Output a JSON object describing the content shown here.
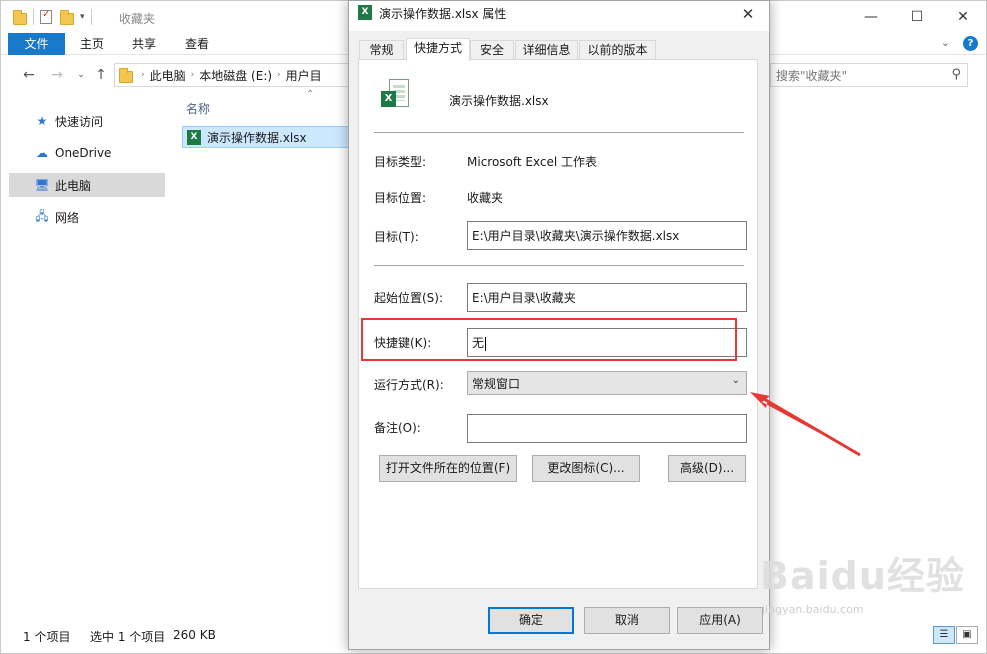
{
  "explorer": {
    "title": "收藏夹",
    "ribbon_tabs": [
      "文件",
      "主页",
      "共享",
      "查看"
    ],
    "help_icon": "?",
    "breadcrumbs": [
      "此电脑",
      "本地磁盘 (E:)",
      "用户目"
    ],
    "search_placeholder": "搜索\"收藏夹\"",
    "nav_items": [
      {
        "label": "快速访问",
        "icon": "star-icon"
      },
      {
        "label": "OneDrive",
        "icon": "cloud-icon"
      },
      {
        "label": "此电脑",
        "icon": "computer-icon",
        "selected": true
      },
      {
        "label": "网络",
        "icon": "network-icon"
      }
    ],
    "column_header": "名称",
    "files": [
      {
        "name": "演示操作数据.xlsx",
        "icon": "excel-file-icon"
      }
    ],
    "status": {
      "item_count": "1 个项目",
      "selected": "选中 1 个项目",
      "size": "260 KB"
    }
  },
  "dialog": {
    "title": "演示操作数据.xlsx 属性",
    "tabs": [
      "常规",
      "快捷方式",
      "安全",
      "详细信息",
      "以前的版本"
    ],
    "active_tab": "快捷方式",
    "file_name": "演示操作数据.xlsx",
    "target_type_label": "目标类型:",
    "target_type_value": "Microsoft Excel 工作表",
    "target_location_label": "目标位置:",
    "target_location_value": "收藏夹",
    "target_label": "目标(T):",
    "target_value": "E:\\用户目录\\收藏夹\\演示操作数据.xlsx",
    "start_in_label": "起始位置(S):",
    "start_in_value": "E:\\用户目录\\收藏夹",
    "shortcut_key_label": "快捷键(K):",
    "shortcut_key_value": "无",
    "run_label": "运行方式(R):",
    "run_value": "常规窗口",
    "comment_label": "备注(O):",
    "comment_value": "",
    "buttons": {
      "open_location": "打开文件所在的位置(F)",
      "change_icon": "更改图标(C)...",
      "advanced": "高级(D)..."
    },
    "footer": {
      "ok": "确定",
      "cancel": "取消",
      "apply": "应用(A)"
    }
  },
  "watermark": {
    "brand": "Baidu经验",
    "url": "jingyan.baidu.com"
  },
  "annotation_color": "#e53935"
}
